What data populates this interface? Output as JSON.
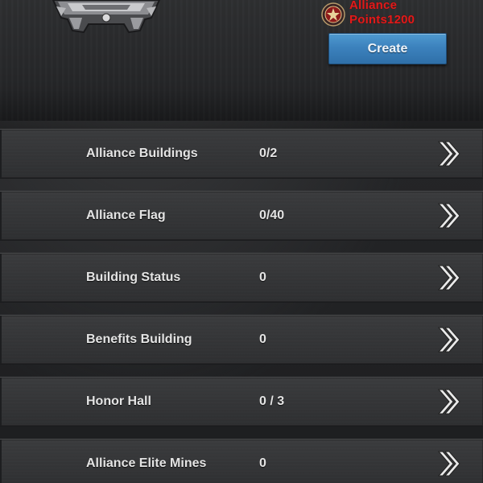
{
  "alliance_points": {
    "line1": "Alliance",
    "line2": "Points1200",
    "color": "#e01b1b"
  },
  "create_button": {
    "label": "Create",
    "color": "#3c82bd"
  },
  "rows": [
    {
      "label": "Alliance Buildings",
      "value": "0/2",
      "icon": "double-chevron-right-icon"
    },
    {
      "label": "Alliance Flag",
      "value": "0/40",
      "icon": "double-chevron-right-icon"
    },
    {
      "label": "Building Status",
      "value": "0",
      "icon": "double-chevron-right-icon"
    },
    {
      "label": "Benefits Building",
      "value": "0",
      "icon": "double-chevron-right-icon"
    },
    {
      "label": "Honor Hall",
      "value": "0 / 3",
      "icon": "double-chevron-right-icon"
    },
    {
      "label": "Alliance Elite Mines",
      "value": "0",
      "icon": "double-chevron-right-icon"
    }
  ]
}
